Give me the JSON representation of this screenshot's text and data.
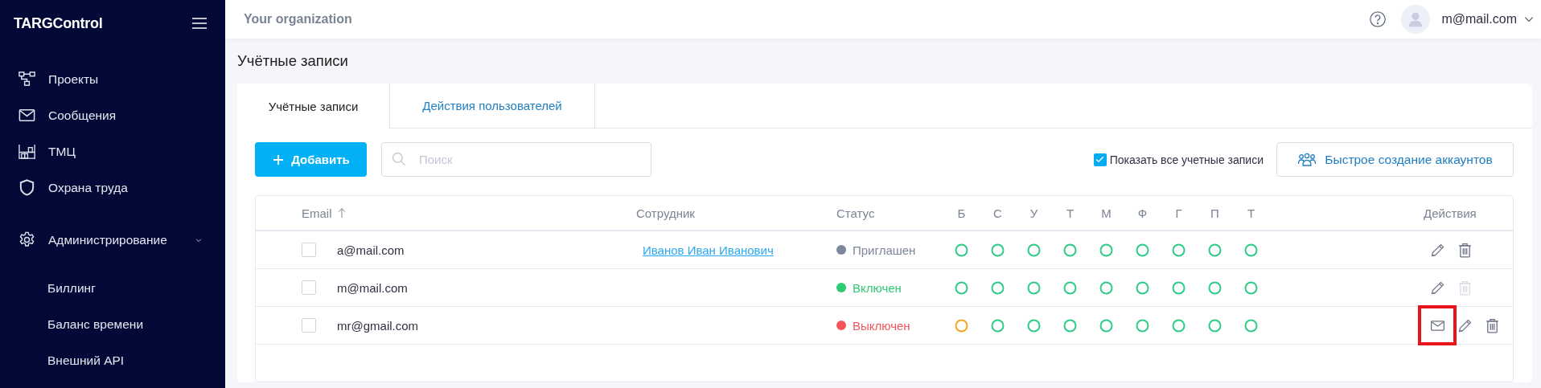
{
  "header": {
    "logo": "TARGControl",
    "organization": "Your organization",
    "user": "m@mail.com"
  },
  "sidebar": {
    "items": [
      {
        "kind": "projects",
        "label": "Проекты"
      },
      {
        "kind": "messages",
        "label": "Сообщения"
      },
      {
        "kind": "inventory",
        "label": "ТМЦ"
      },
      {
        "kind": "safety",
        "label": "Охрана труда"
      },
      {
        "kind": "admin",
        "label": "Администрирование",
        "expanded": true,
        "children": [
          {
            "label": "Биллинг"
          },
          {
            "label": "Баланс времени"
          },
          {
            "label": "Внешний API"
          }
        ]
      }
    ]
  },
  "page_title": "Учётные записи",
  "tabs": [
    {
      "label": "Учётные записи",
      "selected": true
    },
    {
      "label": "Действия пользователей",
      "selected": false
    }
  ],
  "toolbar": {
    "add_button": "Добавить",
    "search": {
      "placeholder": "Поиск"
    },
    "show_all": {
      "label": "Показать все учетные записи",
      "checked": true
    },
    "quick_create_button": "Быстрое создание аккаунтов"
  },
  "table": {
    "columns": {
      "email": "Email",
      "email_sort_ascending": true,
      "employee": "Сотрудник",
      "status": "Статус",
      "days": [
        "Б",
        "С",
        "У",
        "Т",
        "М",
        "Ф",
        "Г",
        "П",
        "Т"
      ],
      "actions": "Действия"
    },
    "rows": [
      {
        "checked": false,
        "email": "a@mail.com",
        "employee": "Иванов Иван Иванович",
        "status": {
          "label": "Приглашен",
          "color": "#7d869c"
        },
        "days": [
          {
            "color": "#2ecc87"
          },
          {
            "color": "#2ecc87"
          },
          {
            "color": "#2ecc87"
          },
          {
            "color": "#2ecc87"
          },
          {
            "color": "#2ecc87"
          },
          {
            "color": "#2ecc87"
          },
          {
            "color": "#2ecc87"
          },
          {
            "color": "#2ecc87"
          },
          {
            "color": "#2ecc87"
          }
        ],
        "actions": [
          {
            "kind": "edit",
            "disabled": false,
            "highlighted": false
          },
          {
            "kind": "delete",
            "disabled": false,
            "highlighted": false
          }
        ]
      },
      {
        "checked": false,
        "email": "m@mail.com",
        "status": {
          "label": "Включен",
          "color": "#2ecc71"
        },
        "days": [
          {
            "color": "#2ecc87"
          },
          {
            "color": "#2ecc87"
          },
          {
            "color": "#2ecc87"
          },
          {
            "color": "#2ecc87"
          },
          {
            "color": "#2ecc87"
          },
          {
            "color": "#2ecc87"
          },
          {
            "color": "#2ecc87"
          },
          {
            "color": "#2ecc87"
          },
          {
            "color": "#2ecc87"
          }
        ],
        "actions": [
          {
            "kind": "edit",
            "disabled": false,
            "highlighted": false
          },
          {
            "kind": "delete",
            "disabled": true,
            "highlighted": false
          }
        ]
      },
      {
        "checked": false,
        "email": "mr@gmail.com",
        "status": {
          "label": "Выключен",
          "color": "#f5555b"
        },
        "days": [
          {
            "color": "#f5a623"
          },
          {
            "color": "#2ecc87"
          },
          {
            "color": "#2ecc87"
          },
          {
            "color": "#2ecc87"
          },
          {
            "color": "#2ecc87"
          },
          {
            "color": "#2ecc87"
          },
          {
            "color": "#2ecc87"
          },
          {
            "color": "#2ecc87"
          },
          {
            "color": "#2ecc87"
          }
        ],
        "actions": [
          {
            "kind": "mail",
            "disabled": false,
            "highlighted": true
          },
          {
            "kind": "edit",
            "disabled": false,
            "highlighted": false
          },
          {
            "kind": "delete",
            "disabled": false,
            "highlighted": false
          }
        ]
      }
    ]
  }
}
